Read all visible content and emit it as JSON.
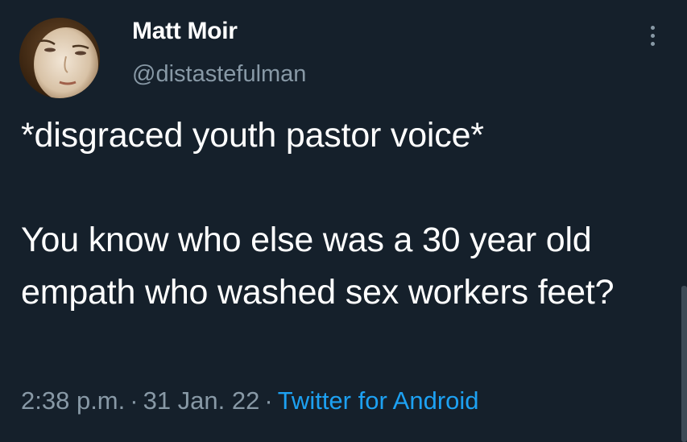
{
  "author": {
    "display_name": "Matt Moir",
    "handle": "@distastefulman",
    "avatar_icon": "portrait-avatar"
  },
  "tweet": {
    "text": "*disgraced youth pastor voice*\n\nYou know who else was a 30 year old empath who washed sex workers feet?"
  },
  "meta": {
    "time": "2:38 p.m.",
    "separator": "·",
    "date": "31 Jan. 22",
    "source": "Twitter for Android"
  },
  "icons": {
    "more": "more-options-icon"
  },
  "colors": {
    "background": "#15202b",
    "secondary_text": "#8899a6",
    "link": "#1da1f2"
  }
}
